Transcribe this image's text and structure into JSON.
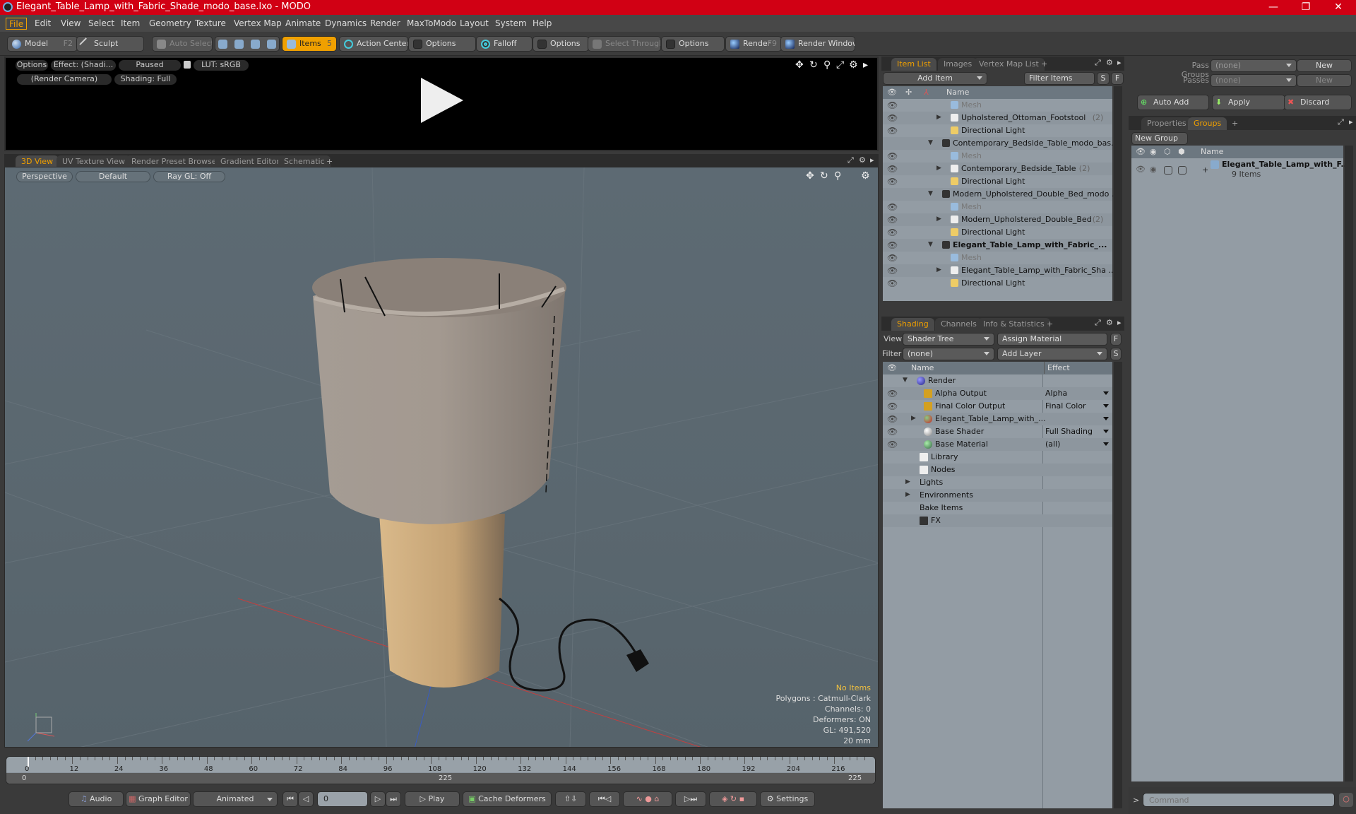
{
  "window": {
    "title": "Elegant_Table_Lamp_with_Fabric_Shade_modo_base.lxo - MODO",
    "controls": {
      "minimize": "—",
      "restore": "❐",
      "close": "✕"
    }
  },
  "menu": [
    "File",
    "Edit",
    "View",
    "Select",
    "Item",
    "Geometry",
    "Texture",
    "Vertex Map",
    "Animate",
    "Dynamics",
    "Render",
    "MaxToModo",
    "Layout",
    "System",
    "Help"
  ],
  "toolbar": {
    "model": "Model",
    "model_key": "F2",
    "sculpt": "Sculpt",
    "auto_select": "Auto Select",
    "items": "Items",
    "items_key": "5",
    "action_center": "Action Center",
    "options1": "Options",
    "falloff": "Falloff",
    "options2": "Options",
    "select_through": "Select Through",
    "options3": "Options",
    "render": "Render",
    "render_key": "F9",
    "render_window": "Render Window"
  },
  "preview": {
    "options": "Options",
    "effect": "Effect: (Shadi...",
    "paused": "Paused",
    "lut": "LUT: sRGB",
    "camera": "(Render Camera)",
    "shading": "Shading: Full"
  },
  "viewport_tabs": [
    "3D View",
    "UV Texture View",
    "Render Preset Browser",
    "Gradient Editor",
    "Schematic",
    "+"
  ],
  "viewport": {
    "perspective": "Perspective",
    "default": "Default",
    "raygl": "Ray GL: Off",
    "info": {
      "items": "No Items",
      "polygons": "Polygons : Catmull-Clark",
      "channels": "Channels: 0",
      "deformers": "Deformers: ON",
      "gl": "GL: 491,520",
      "unit": "20 mm"
    },
    "colors": {
      "accent": "#f0a000",
      "lamp_shade": "#a49a92",
      "lamp_base": "#c9a87a"
    }
  },
  "timeline": {
    "ticks": [
      "0",
      "12",
      "24",
      "36",
      "48",
      "60",
      "72",
      "84",
      "96",
      "108",
      "120",
      "132",
      "144",
      "156",
      "168",
      "180",
      "192",
      "204",
      "216"
    ],
    "range_start": "0",
    "range_mid": "225",
    "range_end": "225"
  },
  "transport": {
    "audio": "Audio",
    "graph_editor": "Graph Editor",
    "animated": "Animated",
    "frame": "0",
    "play": "Play",
    "cache_deformers": "Cache Deformers",
    "settings": "Settings"
  },
  "item_list": {
    "tabs": [
      "Item List",
      "Images",
      "Vertex Map List",
      "+"
    ],
    "add_item": "Add Item",
    "filter": "Filter Items",
    "s": "S",
    "f": "F",
    "col_name": "Name",
    "rows": [
      {
        "label": "Mesh",
        "count": "",
        "indent": 3,
        "type": "mesh",
        "dim": true,
        "eye": true
      },
      {
        "label": "Upholstered_Ottoman_Footstool",
        "count": "(2)",
        "indent": 3,
        "type": "group",
        "eye": true,
        "expander": "right"
      },
      {
        "label": "Directional Light",
        "count": "",
        "indent": 3,
        "type": "light",
        "eye": true
      },
      {
        "label": "Contemporary_Bedside_Table_modo_bas...",
        "count": "",
        "indent": 2,
        "type": "scene",
        "eye": false,
        "expander": "down"
      },
      {
        "label": "Mesh",
        "count": "",
        "indent": 3,
        "type": "mesh",
        "dim": true,
        "eye": true
      },
      {
        "label": "Contemporary_Bedside_Table",
        "count": "(2)",
        "indent": 3,
        "type": "group",
        "eye": true,
        "expander": "right"
      },
      {
        "label": "Directional Light",
        "count": "",
        "indent": 3,
        "type": "light",
        "eye": true
      },
      {
        "label": "Modern_Upholstered_Double_Bed_modo ...",
        "count": "",
        "indent": 2,
        "type": "scene",
        "eye": false,
        "expander": "down"
      },
      {
        "label": "Mesh",
        "count": "",
        "indent": 3,
        "type": "mesh",
        "dim": true,
        "eye": true
      },
      {
        "label": "Modern_Upholstered_Double_Bed",
        "count": "(2)",
        "indent": 3,
        "type": "group",
        "eye": true,
        "expander": "right"
      },
      {
        "label": "Directional Light",
        "count": "",
        "indent": 3,
        "type": "light",
        "eye": true
      },
      {
        "label": "Elegant_Table_Lamp_with_Fabric_...",
        "count": "",
        "indent": 2,
        "type": "scene",
        "bold": true,
        "eye": true,
        "expander": "down"
      },
      {
        "label": "Mesh",
        "count": "",
        "indent": 3,
        "type": "mesh",
        "dim": true,
        "eye": true
      },
      {
        "label": "Elegant_Table_Lamp_with_Fabric_Sha ...",
        "count": "",
        "indent": 3,
        "type": "group",
        "eye": true,
        "expander": "right"
      },
      {
        "label": "Directional Light",
        "count": "",
        "indent": 3,
        "type": "light",
        "eye": true
      }
    ]
  },
  "shading": {
    "tabs": [
      "Shading",
      "Channels",
      "Info & Statistics",
      "+"
    ],
    "view_label": "View",
    "view_value": "Shader Tree",
    "assign_material": "Assign Material",
    "f": "F",
    "filter_label": "Filter",
    "filter_value": "(none)",
    "add_layer": "Add Layer",
    "s": "S",
    "col_name": "Name",
    "col_effect": "Effect",
    "rows": [
      {
        "label": "Render",
        "effect": "",
        "indent": 1,
        "icon": "render",
        "eye": false,
        "expander": "down"
      },
      {
        "label": "Alpha Output",
        "effect": "Alpha",
        "indent": 2,
        "icon": "output",
        "eye": true
      },
      {
        "label": "Final Color Output",
        "effect": "Final Color",
        "indent": 2,
        "icon": "output",
        "eye": true
      },
      {
        "label": "Elegant_Table_Lamp_with_...",
        "effect": "",
        "indent": 2,
        "icon": "material-group",
        "eye": true,
        "expander": "right",
        "dropdown": true
      },
      {
        "label": "Base Shader",
        "effect": "Full Shading",
        "indent": 2,
        "icon": "shader",
        "eye": true
      },
      {
        "label": "Base Material",
        "effect": "(all)",
        "indent": 2,
        "icon": "material",
        "eye": true
      },
      {
        "label": "Library",
        "effect": "",
        "indent": 1.5,
        "icon": "folder",
        "eye": false
      },
      {
        "label": "Nodes",
        "effect": "",
        "indent": 1.5,
        "icon": "folder",
        "eye": false
      },
      {
        "label": "Lights",
        "effect": "",
        "indent": 1.5,
        "icon": "",
        "eye": false,
        "expander": "right"
      },
      {
        "label": "Environments",
        "effect": "",
        "indent": 1.5,
        "icon": "",
        "eye": false,
        "expander": "right"
      },
      {
        "label": "Bake Items",
        "effect": "",
        "indent": 1.5,
        "icon": "",
        "eye": false
      },
      {
        "label": "FX",
        "effect": "",
        "indent": 1.5,
        "icon": "clapper",
        "eye": false
      }
    ]
  },
  "passes": {
    "pass_groups_label": "Pass Groups",
    "pass_groups_value": "(none)",
    "new1": "New",
    "passes_label": "Passes",
    "passes_value": "(none)",
    "new2": "New",
    "auto_add": "Auto Add",
    "apply": "Apply",
    "discard": "Discard"
  },
  "groups": {
    "tabs": [
      "Properties",
      "Groups",
      "+"
    ],
    "new_group": "New Group",
    "col_name": "Name",
    "item_name": "Elegant_Table_Lamp_with_F...",
    "item_count": "9 Items"
  },
  "command": {
    "prompt": ">",
    "placeholder": "Command"
  }
}
